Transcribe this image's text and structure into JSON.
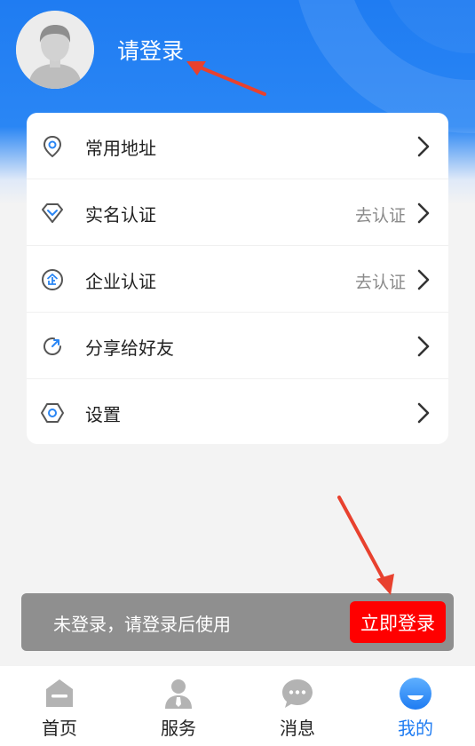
{
  "header": {
    "login_prompt": "请登录"
  },
  "menu": {
    "items": [
      {
        "label": "常用地址",
        "value": "",
        "icon": "location-pin-icon"
      },
      {
        "label": "实名认证",
        "value": "去认证",
        "icon": "diamond-check-icon"
      },
      {
        "label": "企业认证",
        "value": "去认证",
        "icon": "enterprise-icon"
      },
      {
        "label": "分享给好友",
        "value": "",
        "icon": "share-refresh-icon"
      },
      {
        "label": "设置",
        "value": "",
        "icon": "hexagon-settings-icon"
      }
    ]
  },
  "toast": {
    "message": "未登录，请登录后使用",
    "button_label": "立即登录"
  },
  "tabbar": {
    "tabs": [
      {
        "label": "首页",
        "icon": "home-icon"
      },
      {
        "label": "服务",
        "icon": "service-person-icon"
      },
      {
        "label": "消息",
        "icon": "message-bubble-icon"
      },
      {
        "label": "我的",
        "icon": "profile-icon"
      }
    ],
    "active_index": 3
  },
  "colors": {
    "primary": "#1f7cf2",
    "accent": "#ff0000",
    "annotation": "#e8412e"
  }
}
